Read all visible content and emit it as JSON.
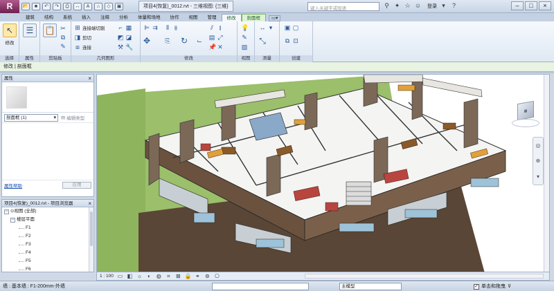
{
  "titlebar": {
    "app_letter": "R",
    "title": "项目4(恢复)_0012.rvt - 三维视图: {三维}",
    "search_placeholder": "键入关键字或短语",
    "login_label": "登录"
  },
  "tabs": [
    "建筑",
    "结构",
    "系统",
    "插入",
    "注释",
    "分析",
    "体量和场地",
    "协作",
    "视图",
    "管理",
    "修改",
    "剖面框"
  ],
  "ribbon": {
    "groups": [
      "选择",
      "属性",
      "剪贴板",
      "几何图形",
      "修改",
      "视图",
      "测量",
      "创建"
    ],
    "modify_label": "修改",
    "join_label": "连接端切割",
    "cut_label": "剪切",
    "connect_label": "连接"
  },
  "optionbar": {
    "text": "修改 | 剖面框"
  },
  "properties": {
    "title": "属性",
    "type_select": "剖面框 (1)",
    "edit_type": "编辑类型",
    "help_link": "属性帮助",
    "apply": "应用"
  },
  "browser": {
    "title": "项目4(恢复)_0012.rvt - 项目浏览器",
    "root": "视图 (全部)",
    "group": "楼层平面",
    "levels": [
      "F1",
      "F2",
      "F3",
      "F4",
      "F5",
      "F6"
    ]
  },
  "viewbar": {
    "scale": "1 : 100"
  },
  "statusbar": {
    "left_text": "墙 : 基本墙 : F1-200mm-外墙",
    "model": "主模型",
    "right_text": "单击和拖曳"
  },
  "icons": {
    "modify": "cursor-arrow-icon",
    "viewcube": "viewcube-icon",
    "wheel": "steering-wheel-icon"
  },
  "colors": {
    "app_button": "#8a2f6a",
    "contextual_tab": "#dff2d8",
    "sky": "#ffffff",
    "ground": "#9bbf6a"
  }
}
